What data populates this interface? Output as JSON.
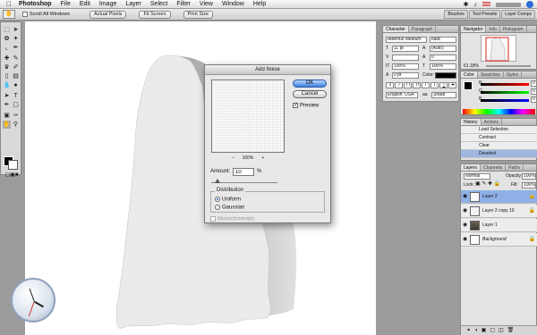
{
  "menubar": {
    "apple": "",
    "items": [
      "Photoshop",
      "File",
      "Edit",
      "Image",
      "Layer",
      "Select",
      "Filter",
      "View",
      "Window",
      "Help"
    ],
    "status_icons": [
      "bluetooth-icon",
      "volume-icon",
      "flag-icon",
      "clock-text",
      "search-icon"
    ]
  },
  "options_bar": {
    "scroll_all_label": "Scroll All Windows",
    "actual_pixels": "Actual Pixels",
    "fit_screen": "Fit Screen",
    "print_size": "Print Size",
    "well_tabs": [
      "Brushes",
      "Tool Presets",
      "Layer Comps"
    ]
  },
  "dialog": {
    "title": "Add Noise",
    "ok": "OK",
    "cancel": "Cancel",
    "preview_label": "Preview",
    "preview_checked": true,
    "zoom_minus": "−",
    "zoom_value": "100%",
    "zoom_plus": "+",
    "amount_label": "Amount:",
    "amount_value": "10",
    "amount_unit": "%",
    "amount_level": 0.1,
    "distribution_label": "Distribution",
    "uniform_label": "Uniform",
    "gaussian_label": "Gaussian",
    "selected_distribution": "Uniform",
    "monochromatic_label": "Monochromatic"
  },
  "character_panel": {
    "tabs": [
      "Character",
      "Paragraph"
    ],
    "font_family": "Albertus Medium",
    "font_style": "Italic",
    "size": "11 pt",
    "leading": "(Auto)",
    "tracking": "",
    "kerning": "0",
    "vscale": "100%",
    "hscale": "100%",
    "baseline": "0 pt",
    "color_label": "Color:",
    "styles": [
      "T",
      "T",
      "TT",
      "Tr",
      "T'",
      "T,",
      "T",
      "T"
    ],
    "language": "English: USA",
    "aa_icon": "aa",
    "aa_value": "Sharp"
  },
  "navigator_panel": {
    "tabs": [
      "Navigator",
      "Info",
      "Histogram"
    ],
    "zoom": "61.18%"
  },
  "color_panel": {
    "tabs": [
      "Color",
      "Swatches",
      "Styles"
    ],
    "channels": [
      "R",
      "G",
      "B"
    ],
    "values": [
      "0",
      "0",
      "0"
    ]
  },
  "history_panel": {
    "tabs": [
      "History",
      "Actions"
    ],
    "items": [
      "Load Selection",
      "Contract",
      "Clear",
      "Deselect"
    ],
    "selected_index": 3
  },
  "layers_panel": {
    "tabs": [
      "Layers",
      "Channels",
      "Paths"
    ],
    "blend_mode": "Normal",
    "opacity_label": "Opacity:",
    "opacity": "100%",
    "lock_label": "Lock:",
    "fill_label": "Fill:",
    "fill": "100%",
    "layers": [
      {
        "name": "Layer 2",
        "selected": true
      },
      {
        "name": "Layer 2 copy 10",
        "selected": false
      },
      {
        "name": "Layer 1",
        "selected": false
      },
      {
        "name": "Background",
        "selected": false
      }
    ]
  },
  "colors": {
    "accent": "#3b7fe0",
    "selection": "#8fb0e6",
    "navigator_box": "#d81e1e"
  }
}
